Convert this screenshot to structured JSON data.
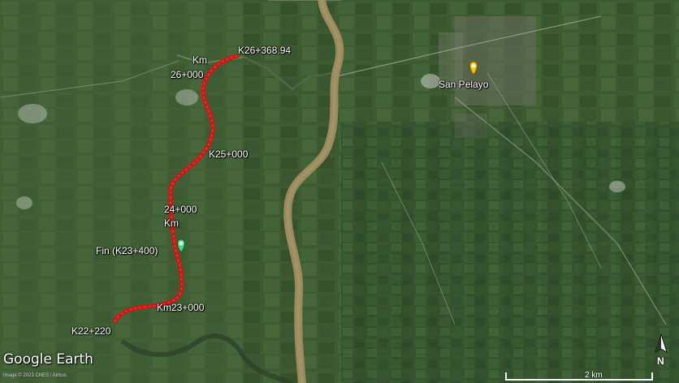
{
  "map": {
    "labels": {
      "start_point": "K26+368.94",
      "km26_prefix": "Km",
      "km26_value": "26+000",
      "km25": "K25+000",
      "km24_value": "24+000",
      "km24_suffix": "Km",
      "end_marker": "Fin (K23+400)",
      "km23": "Km23+000",
      "start_segment": "K22+220",
      "town": "San Pelayo"
    },
    "branding": "Google Earth",
    "credit": "Image © 2023 CNES / Airbus",
    "scale_label": "2 km",
    "north_label": "N",
    "colors": {
      "route": "#d21616",
      "end_pin": "#3ddc84",
      "town_pin": "#f2c200",
      "river": "#9a8a5e"
    },
    "icons": [
      "end-pin-icon",
      "town-pin-icon",
      "north-arrow-icon"
    ]
  }
}
